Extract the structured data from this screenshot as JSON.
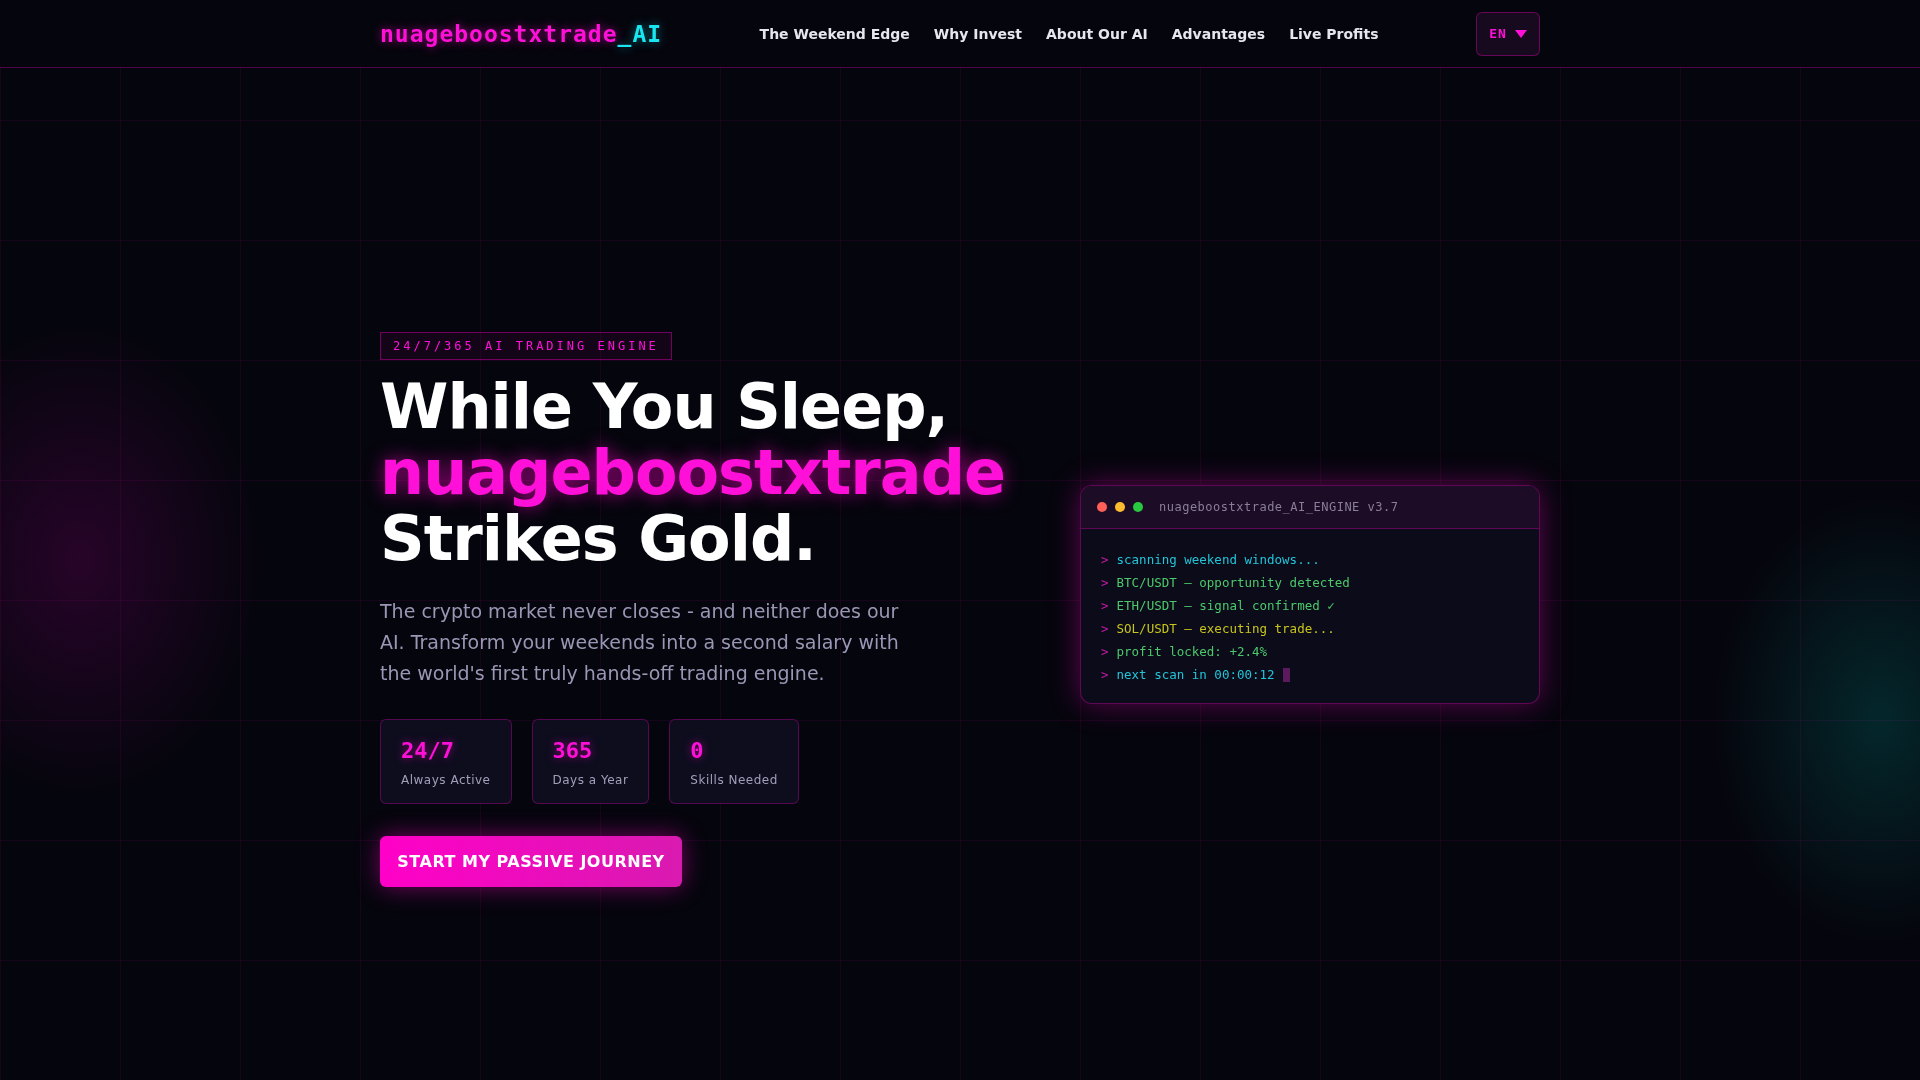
{
  "header": {
    "logo": {
      "name": "nuageboostxtrade",
      "suffix": "_AI"
    },
    "nav": [
      "The Weekend Edge",
      "Why Invest",
      "About Our AI",
      "Advantages",
      "Live Profits"
    ],
    "language": {
      "label": "EN"
    }
  },
  "hero": {
    "badge": "24/7/365 AI TRADING ENGINE",
    "headline": [
      {
        "text": "While You Sleep,",
        "kind": "plain"
      },
      {
        "text": "nuageboostxtrade",
        "kind": "accent"
      },
      {
        "text": "Strikes Gold.",
        "kind": "plain"
      }
    ],
    "description": "The crypto market never closes - and neither does our AI. Transform your weekends into a second salary with the world's first truly hands-off trading engine.",
    "stats": [
      {
        "value": "24/7",
        "label": "Always Active"
      },
      {
        "value": "365",
        "label": "Days a Year"
      },
      {
        "value": "0",
        "label": "Skills Needed"
      }
    ],
    "cta": "START MY PASSIVE JOURNEY"
  },
  "terminal": {
    "title": "nuageboostxtrade_AI_ENGINE v3.7",
    "lines": [
      {
        "prompt": ">",
        "text": "scanning weekend windows...",
        "color": "#22c5d8"
      },
      {
        "prompt": ">",
        "text": "BTC/USDT — opportunity detected",
        "color": "#4cc96a"
      },
      {
        "prompt": ">",
        "text": "ETH/USDT — signal confirmed ✓",
        "color": "#4cc96a"
      },
      {
        "prompt": ">",
        "text": "SOL/USDT — executing trade...",
        "color": "#c8c51c"
      },
      {
        "prompt": ">",
        "text": "profit locked: +2.4%",
        "color": "#4cc96a"
      },
      {
        "prompt": ">",
        "text": "next scan in 00:00:12",
        "color": "#22c5d8",
        "cursor": true
      }
    ]
  }
}
